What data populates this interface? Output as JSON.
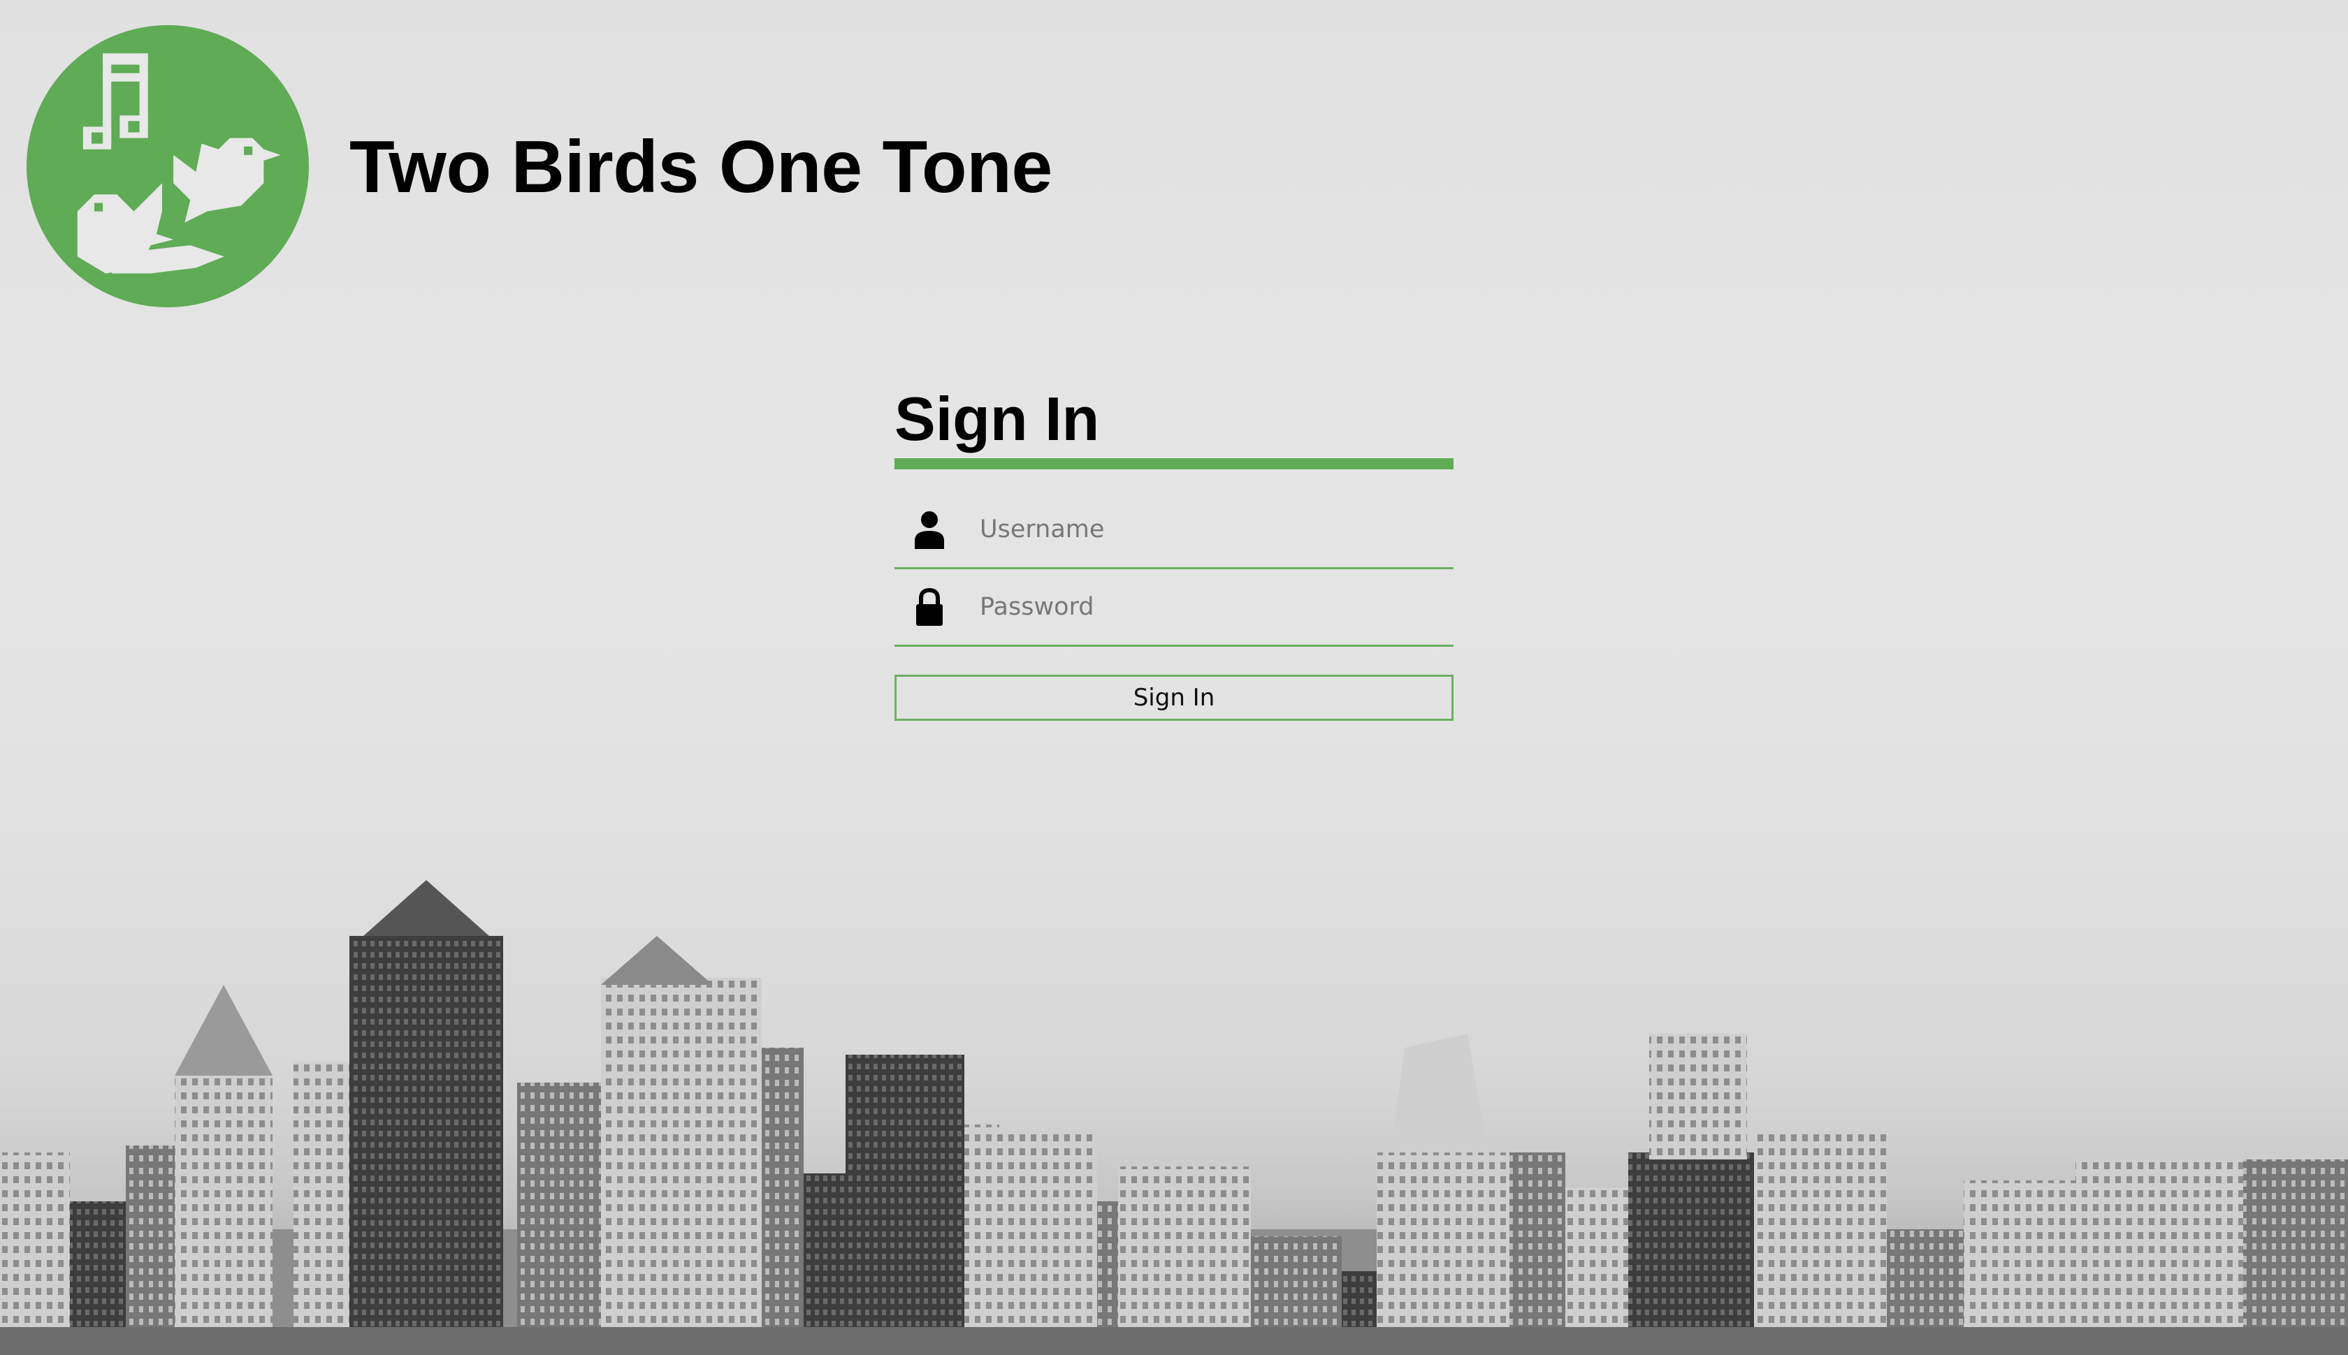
{
  "header": {
    "app_title": "Two Birds One Tone",
    "logo_icon": "two-birds-music-note-logo-icon"
  },
  "signin": {
    "heading": "Sign In",
    "username": {
      "icon": "user-icon",
      "value": "",
      "placeholder": "Username"
    },
    "password": {
      "icon": "lock-icon",
      "value": "",
      "placeholder": "Password"
    },
    "button_label": "Sign In"
  },
  "background": {
    "image": "city-skyline-grayscale"
  },
  "colors": {
    "accent": "#5fab56",
    "background": "#e3e3e3",
    "text": "#000000"
  }
}
